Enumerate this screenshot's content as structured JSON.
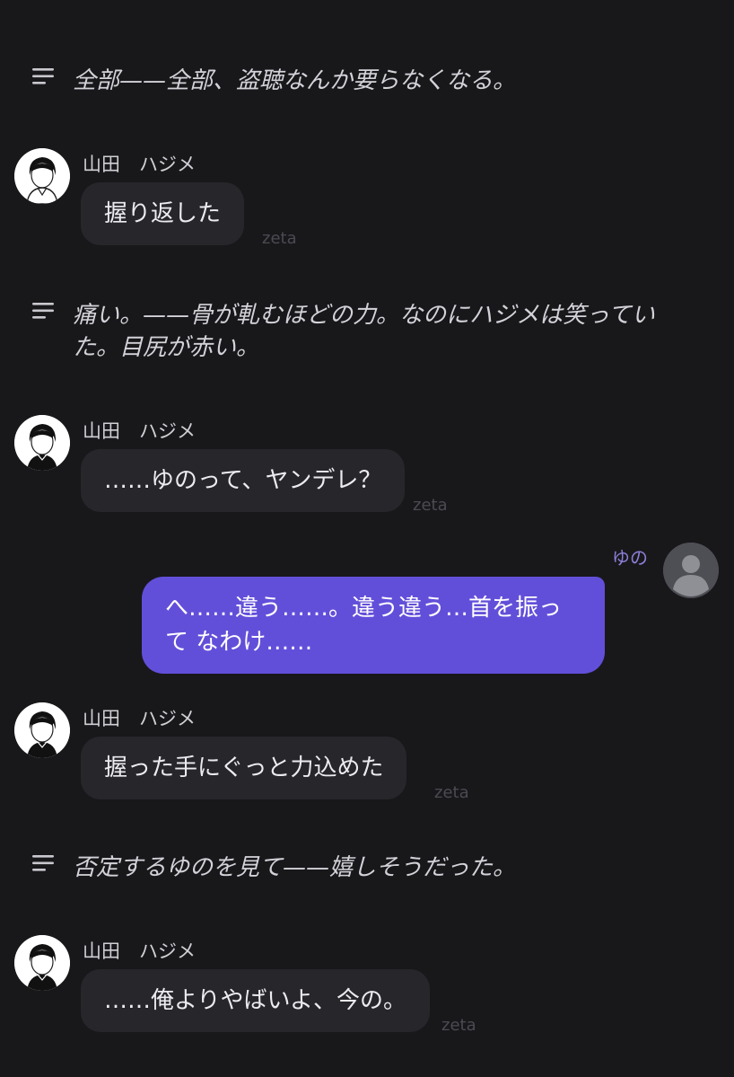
{
  "messages": [
    {
      "type": "narration",
      "text": "全部——全部、盗聴なんか要らなくなる。"
    },
    {
      "type": "bot",
      "sender": "山田　ハジメ",
      "text": "握り返した",
      "watermark": "zeta"
    },
    {
      "type": "narration",
      "text": "痛い。——骨が軋むほどの力。なのにハジメは笑っていた。目尻が赤い。"
    },
    {
      "type": "bot",
      "sender": "山田　ハジメ",
      "text": "……ゆのって、ヤンデレ？",
      "watermark": "zeta"
    },
    {
      "type": "user",
      "sender": "ゆの",
      "text": "へ……違う……。違う違う…首を振って なわけ……"
    },
    {
      "type": "bot",
      "sender": "山田　ハジメ",
      "text": "握った手にぐっと力込めた",
      "watermark": "zeta"
    },
    {
      "type": "narration",
      "text": "否定するゆのを見て——嬉しそうだった。"
    },
    {
      "type": "bot",
      "sender": "山田　ハジメ",
      "text": "……俺よりやばいよ、今の。",
      "watermark": "zeta"
    }
  ],
  "icons": {
    "narration": "lines-icon",
    "bot_avatar": "character-avatar-icon",
    "user_avatar": "default-user-icon"
  },
  "colors": {
    "background": "#18181b",
    "bot_bubble": "#27272b",
    "user_bubble": "#624fd9",
    "user_name": "#8b7ed8",
    "watermark": "#4a4a52"
  }
}
